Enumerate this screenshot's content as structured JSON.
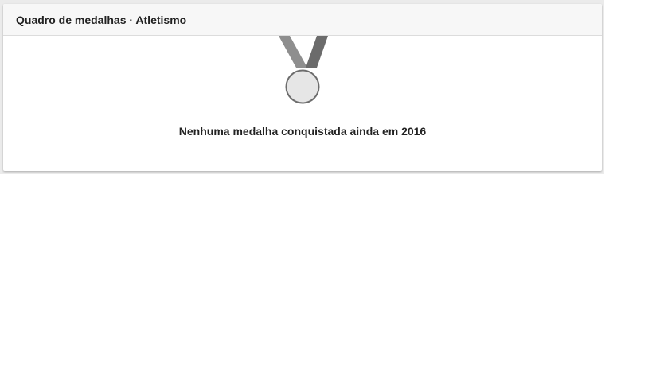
{
  "widget": {
    "title": "Quadro de medalhas · Atletismo",
    "empty_message": "Nenhuma medalha conquistada ainda em 2016",
    "icon": "medal-icon"
  },
  "colors": {
    "ribbon_left": "#8e8e8e",
    "ribbon_right": "#6b6b6b",
    "medal_fill": "#e6e6e6",
    "medal_stroke": "#6d6d6d",
    "text": "#222222",
    "header_bg": "#f7f7f7"
  }
}
